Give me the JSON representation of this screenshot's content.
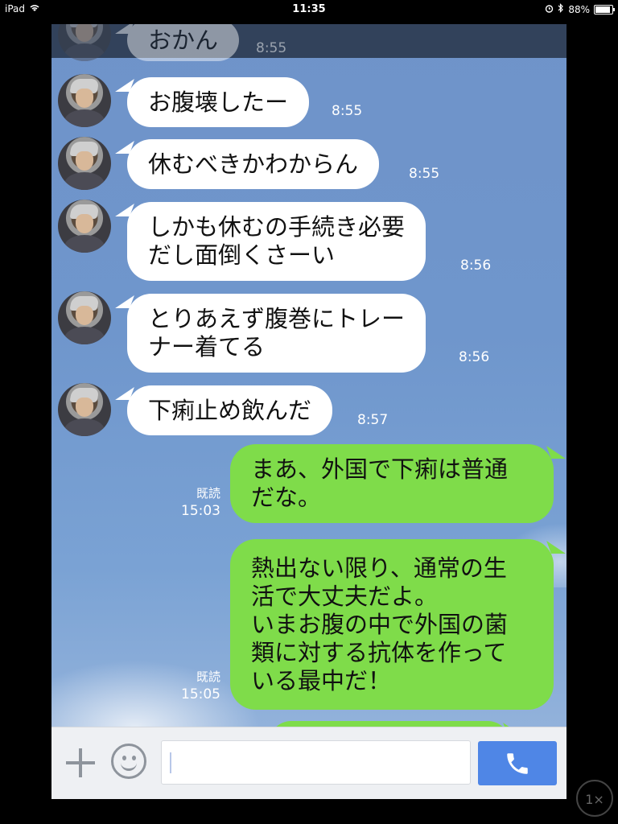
{
  "status_bar": {
    "device": "iPad",
    "time": "11:35",
    "battery_percent": "88%",
    "battery_level": 0.88
  },
  "chat": {
    "partial_top": {
      "text": "おかん",
      "time": "8:55"
    },
    "incoming": [
      {
        "lines": [
          "お腹壊したー"
        ],
        "time": "8:55"
      },
      {
        "lines": [
          "休むべきかわからん"
        ],
        "time": "8:55"
      },
      {
        "lines": [
          "しかも休むの手続き必要",
          "だし面倒くさーい"
        ],
        "time": "8:56"
      },
      {
        "lines": [
          "とりあえず腹巻にトレー",
          "ナー着てる"
        ],
        "time": "8:56"
      },
      {
        "lines": [
          "下痢止め飲んだ"
        ],
        "time": "8:57"
      }
    ],
    "outgoing": [
      {
        "lines": [
          "まあ、外国で下痢は普通",
          "だな。"
        ],
        "read": "既読",
        "time": "15:03"
      },
      {
        "lines": [
          "熱出ない限り、通常の生",
          "活で大丈夫だよ。",
          "いまお腹の中で外国の菌",
          "類に対する抗体を作って",
          "いる最中だ！"
        ],
        "read": "既読",
        "time": "15:05"
      }
    ]
  },
  "input_bar": {
    "plus_icon": "plus-icon",
    "emoji_icon": "smiley-icon",
    "text_value": "",
    "call_icon": "phone-icon",
    "accent": "#4f86e6"
  },
  "zoom_badge": "1×",
  "colors": {
    "outgoing_bubble": "#7fdc4a",
    "incoming_bubble": "#ffffff",
    "background": "#6f93c9"
  }
}
